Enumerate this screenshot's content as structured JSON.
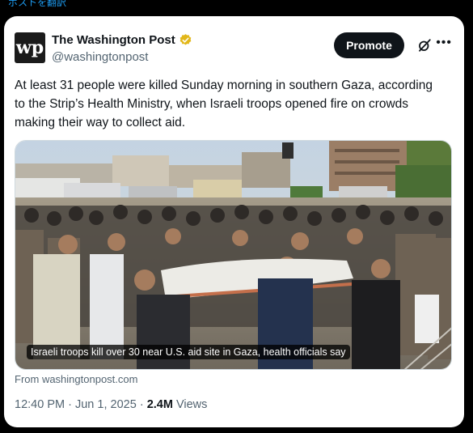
{
  "translate_link": "ポストを翻訳",
  "post": {
    "author": {
      "display_name": "The Washington Post",
      "handle": "@washingtonpost",
      "logo_text": "wp",
      "verified_icon": "gold-verified-badge-icon"
    },
    "promote_label": "Promote",
    "grok_icon": "grok-icon",
    "more_icon": "more-horizontal-icon",
    "text": "At least 31 people were killed Sunday morning in southern Gaza, according to the Strip’s Health Ministry, when Israeli troops opened fire on crowds making their way to collect aid.",
    "media": {
      "caption": "Israeli troops kill over 30 near U.S. aid site in Gaza, health officials say"
    },
    "link_source": "From washingtonpost.com",
    "time": "12:40 PM",
    "separator": "·",
    "date": "Jun 1, 2025",
    "views_count": "2.4M",
    "views_label": "Views"
  },
  "colors": {
    "background": "#000000",
    "card": "#ffffff",
    "text_primary": "#0f1419",
    "text_secondary": "#536471",
    "link": "#1d9bf0",
    "verified_gold": "#e2b719"
  }
}
